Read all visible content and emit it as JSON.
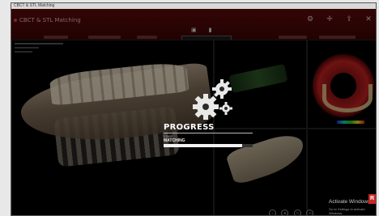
{
  "window": {
    "os_title": "CBCT & STL Matching",
    "app_title": "CBCT & STL Matching"
  },
  "header": {
    "buttons": [
      {
        "icon": "settings-icon",
        "glyph": "⚙"
      },
      {
        "icon": "crosshair-icon",
        "glyph": "✛"
      },
      {
        "icon": "export-icon",
        "glyph": "⇪"
      },
      {
        "icon": "close-icon",
        "glyph": "✕"
      }
    ]
  },
  "center_toolbar": [
    {
      "icon": "camera-icon",
      "glyph": "▣"
    },
    {
      "icon": "layer-icon",
      "glyph": "▮"
    }
  ],
  "progress": {
    "title": "PROGRESS",
    "step_label": "STAGE",
    "step_value": "MATCHING",
    "fraction": 0.88
  },
  "watermark": {
    "title": "Activate Windows",
    "subtitle": "Go to Settings to activate Windows."
  },
  "corner_badge": "R",
  "viewport_tools": [
    {
      "icon": "zoom-icon",
      "glyph": "+"
    },
    {
      "icon": "pan-icon",
      "glyph": "✥"
    },
    {
      "icon": "rotate-icon",
      "glyph": "↻"
    },
    {
      "icon": "reset-icon",
      "glyph": "⟲"
    }
  ],
  "colors": {
    "header": "#5a0a0a",
    "accent": "#c62828",
    "progress_fill": "#f2f2f2"
  }
}
